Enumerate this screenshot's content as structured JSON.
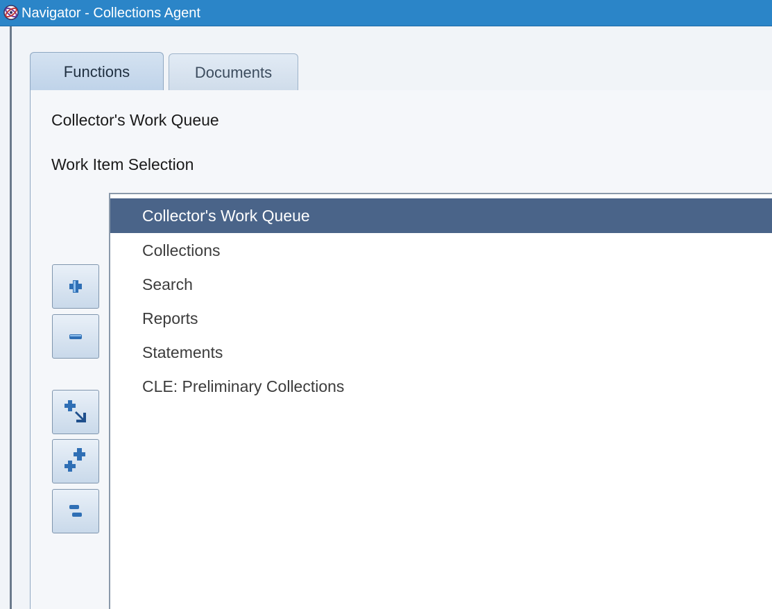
{
  "window": {
    "title": "Navigator - Collections Agent",
    "icon": "oracle-logo-icon"
  },
  "tabs": [
    {
      "label": "Functions",
      "active": true
    },
    {
      "label": "Documents",
      "active": false
    }
  ],
  "top_functions": [
    "Collector's Work Queue",
    "Work Item Selection"
  ],
  "tree": {
    "selected_index": 0,
    "items": [
      "Collector's Work Queue",
      "Collections",
      "Search",
      "Reports",
      "Statements",
      "CLE: Preliminary Collections"
    ]
  },
  "side_buttons": [
    {
      "icon": "plus-icon"
    },
    {
      "icon": "minus-icon"
    },
    {
      "icon": "expand-branch-icon"
    },
    {
      "icon": "expand-all-icon"
    },
    {
      "icon": "collapse-all-icon"
    }
  ],
  "colors": {
    "titlebar": "#2b85c8",
    "selected_row": "#4a6489"
  }
}
